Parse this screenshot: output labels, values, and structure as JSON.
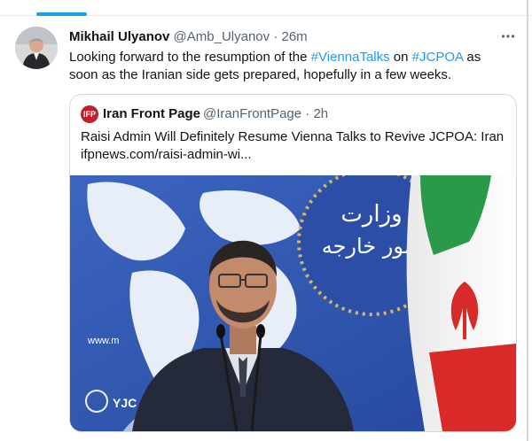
{
  "colors": {
    "link": "#1d9bf0",
    "secondary_text": "#536471",
    "border": "#cfd9de"
  },
  "tweet": {
    "author_name": "Mikhail Ulyanov",
    "author_handle": "@Amb_Ulyanov",
    "separator": "·",
    "time": "26m",
    "more_icon": "more-horizontal-icon",
    "text_1": "Looking forward to the resumption of the ",
    "hashtag_1": "#ViennaTalks",
    "text_2": " on ",
    "hashtag_2": "#JCPOA",
    "text_3": " as soon as the Iranian side gets prepared, hopefully in a few weeks."
  },
  "quote": {
    "logo_text": "IFP",
    "author_name": "Iran Front Page",
    "author_handle": "@IranFrontPage",
    "time": "2h",
    "title": "Raisi Admin Will Definitely Resume Vienna Talks to Revive JCPOA: Iran",
    "url": "ifpnews.com/raisi-admin-wi..."
  },
  "image": {
    "wall_text_line1": "وزارت",
    "wall_text_line2": "امور خارجه",
    "watermark": "YJC"
  }
}
